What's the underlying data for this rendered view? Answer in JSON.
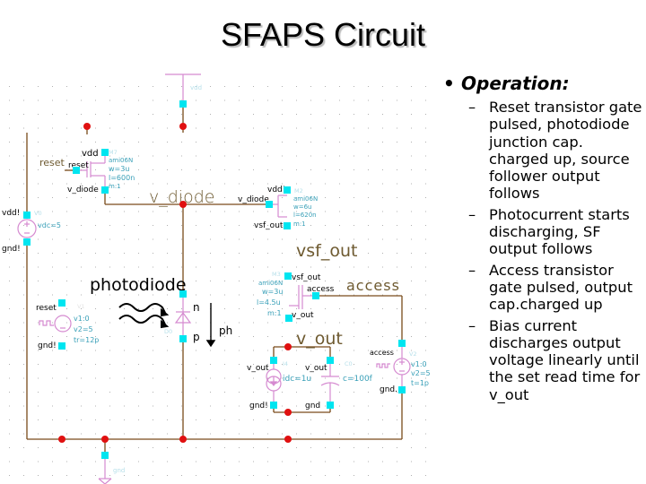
{
  "title": "SFAPS Circuit",
  "operation": {
    "heading": "Operation:",
    "items": [
      "Reset transistor gate pulsed, photodiode junction cap. charged up, source follower output follows",
      "Photocurrent starts discharging, SF output follows",
      "Access transistor gate pulsed, output cap.charged up",
      "Bias current discharges output voltage linearly until the set read time for v_out"
    ]
  },
  "schematic": {
    "colors": {
      "wire": "#7a4a1a",
      "symbol": "#d58ad0",
      "pin": "#00e5f0",
      "junction": "#e01010",
      "param": "#3aa0b8",
      "label": "#000000",
      "net_label": "#6e5a30",
      "grid": "#b0b0b0"
    },
    "net_labels": {
      "v_diode": "v_diode",
      "vsf_out": "vsf_out",
      "access": "access",
      "v_out": "v_out",
      "photodiode": "photodiode",
      "reset": "reset"
    },
    "vdd_symbol": {
      "label": "vdd"
    },
    "gnd_symbol": {
      "label": "gnd"
    },
    "reset_transistor": {
      "name": "M7",
      "model": "ami06N",
      "w": "w=3u",
      "l": "l=600n",
      "m": "m:1",
      "pins": {
        "drain": "vdd",
        "gate": "reset",
        "source": "v_diode"
      }
    },
    "sf_transistor": {
      "name": "M2",
      "model": "ami06N",
      "w": "w=6u",
      "l": "l=620n",
      "m": "m:1",
      "pins": {
        "drain": "vdd!",
        "gate": "v_diode",
        "source": "vsf_out"
      }
    },
    "access_transistor": {
      "name": "M3",
      "model": "ami06N",
      "w": "w=3u",
      "l": "l=4.5u",
      "m": "m:1",
      "pins": {
        "drain": "vsf_out",
        "gate": "access",
        "source": "v_out"
      }
    },
    "vdd_source": {
      "name": "V0",
      "pins": {
        "plus": "vdd!",
        "minus": "gnd!"
      },
      "param": "vdc=5"
    },
    "reset_pulse": {
      "name": "V1",
      "pins": {
        "plus": "reset",
        "minus": "gnd!"
      },
      "params": [
        "v1:0",
        "v2=5",
        "tr=12p"
      ]
    },
    "access_pulse": {
      "name": "V2",
      "pins": {
        "plus": "access",
        "minus": "gnd."
      },
      "params": [
        "v1:0",
        "v2=5",
        "t=1p"
      ]
    },
    "photodiode": {
      "name": "D0",
      "pins": {
        "n": "n",
        "p": "p"
      },
      "current_label": "ph"
    },
    "bias_current": {
      "name": "I4",
      "pins": {
        "top": "v_out",
        "bottom": "gnd!"
      },
      "param": "idc=1u"
    },
    "output_cap": {
      "name": "C0",
      "pins": {
        "top": "v_out",
        "bottom": "gnd"
      },
      "param": "c=100f"
    }
  }
}
